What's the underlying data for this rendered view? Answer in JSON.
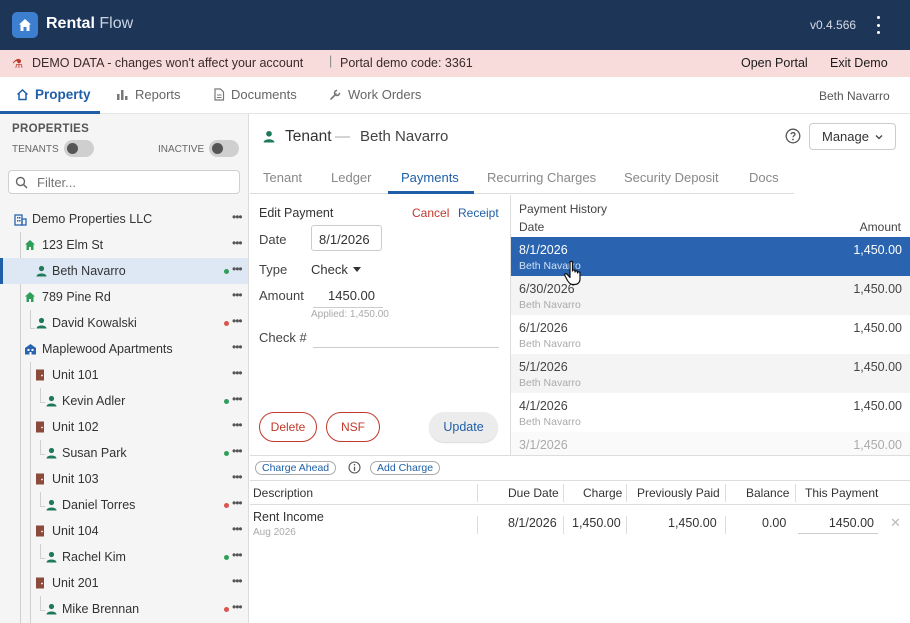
{
  "app": {
    "name_bold": "Rental",
    "name_light": "Flow",
    "version": "v0.4.566"
  },
  "demo_banner": {
    "message": "DEMO DATA - changes won't affect your account",
    "separator": "|",
    "portal_code": "Portal demo code: 3361",
    "open_portal": "Open Portal",
    "exit_demo": "Exit Demo"
  },
  "nav": {
    "items": [
      {
        "label": "Property",
        "icon": "home-icon",
        "active": true
      },
      {
        "label": "Reports",
        "icon": "bar-chart-icon",
        "active": false
      },
      {
        "label": "Documents",
        "icon": "document-icon",
        "active": false
      },
      {
        "label": "Work Orders",
        "icon": "wrench-icon",
        "active": false
      }
    ],
    "user": "Beth Navarro"
  },
  "sidebar": {
    "title": "PROPERTIES",
    "toggle_tenants": "TENANTS",
    "toggle_inactive": "INACTIVE",
    "filter_placeholder": "Filter...",
    "tree": [
      {
        "label": "Demo Properties LLC",
        "type": "company"
      },
      {
        "label": "123 Elm St",
        "type": "house"
      },
      {
        "label": "Beth Navarro",
        "type": "tenant",
        "status": "green",
        "selected": true
      },
      {
        "label": "789 Pine Rd",
        "type": "house"
      },
      {
        "label": "David Kowalski",
        "type": "tenant",
        "status": "red"
      },
      {
        "label": "Maplewood Apartments",
        "type": "building"
      },
      {
        "label": "Unit 101",
        "type": "unit"
      },
      {
        "label": "Kevin Adler",
        "type": "tenant",
        "status": "green"
      },
      {
        "label": "Unit 102",
        "type": "unit"
      },
      {
        "label": "Susan Park",
        "type": "tenant",
        "status": "green"
      },
      {
        "label": "Unit 103",
        "type": "unit"
      },
      {
        "label": "Daniel Torres",
        "type": "tenant",
        "status": "red"
      },
      {
        "label": "Unit 104",
        "type": "unit"
      },
      {
        "label": "Rachel Kim",
        "type": "tenant",
        "status": "green"
      },
      {
        "label": "Unit 201",
        "type": "unit"
      },
      {
        "label": "Mike Brennan",
        "type": "tenant",
        "status": "red"
      }
    ]
  },
  "header": {
    "section": "Tenant",
    "dash": "—",
    "name": "Beth Navarro",
    "manage": "Manage"
  },
  "tabs": [
    "Tenant",
    "Ledger",
    "Payments",
    "Recurring Charges",
    "Security Deposit",
    "Docs"
  ],
  "active_tab": "Payments",
  "edit_payment": {
    "title": "Edit Payment",
    "cancel": "Cancel",
    "receipt": "Receipt",
    "date_label": "Date",
    "date_value": "8/1/2026",
    "type_label": "Type",
    "type_value": "Check",
    "amount_label": "Amount",
    "amount_value": "1450.00",
    "applied": "Applied: 1,450.00",
    "check_label": "Check #",
    "check_value": "",
    "delete": "Delete",
    "nsf": "NSF",
    "update": "Update"
  },
  "history": {
    "title": "Payment History",
    "col_date": "Date",
    "col_amount": "Amount",
    "rows": [
      {
        "date": "8/1/2026",
        "name": "Beth Navarro",
        "amount": "1,450.00",
        "selected": true
      },
      {
        "date": "6/30/2026",
        "name": "Beth Navarro",
        "amount": "1,450.00"
      },
      {
        "date": "6/1/2026",
        "name": "Beth Navarro",
        "amount": "1,450.00"
      },
      {
        "date": "5/1/2026",
        "name": "Beth Navarro",
        "amount": "1,450.00"
      },
      {
        "date": "4/1/2026",
        "name": "Beth Navarro",
        "amount": "1,450.00"
      },
      {
        "date": "3/1/2026",
        "name": "",
        "amount": "1,450.00"
      }
    ]
  },
  "charges": {
    "charge_ahead": "Charge Ahead",
    "add_charge": "Add Charge",
    "columns": [
      "Description",
      "Due Date",
      "Charge",
      "Previously Paid",
      "Balance",
      "This Payment"
    ],
    "rows": [
      {
        "description": "Rent Income",
        "period": "Aug 2026",
        "due_date": "8/1/2026",
        "charge": "1,450.00",
        "previously_paid": "1,450.00",
        "balance": "0.00",
        "this_payment": "1450.00"
      }
    ]
  },
  "colors": {
    "primary": "#1f5fa8",
    "topbar": "#1d3557",
    "danger": "#c0392b",
    "banner": "#f8dcdc",
    "selected_row": "#2a64b0",
    "status_green": "#2e9e5b",
    "status_red": "#d9534f"
  }
}
